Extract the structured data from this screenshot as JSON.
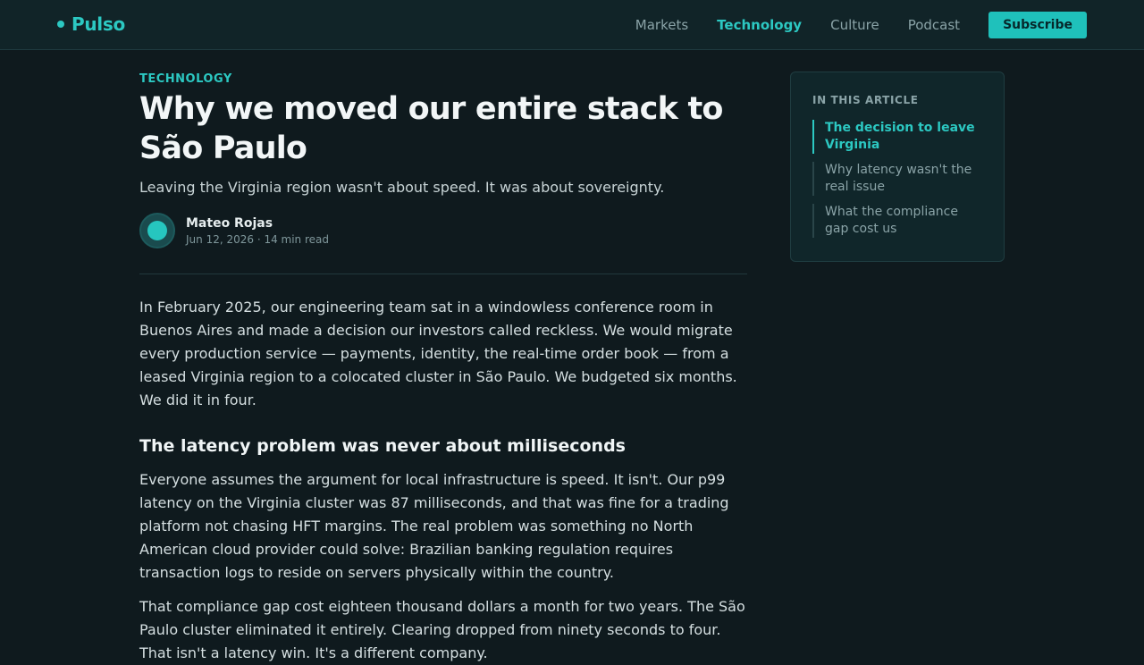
{
  "brand": {
    "name": "Pulso"
  },
  "nav": {
    "items": [
      {
        "label": "Markets"
      },
      {
        "label": "Technology",
        "active": true
      },
      {
        "label": "Culture"
      },
      {
        "label": "Podcast"
      }
    ],
    "subscribe_label": "Subscribe"
  },
  "article": {
    "kicker": "TECHNOLOGY",
    "title": "Why we moved our entire stack to São Paulo",
    "dek": "Leaving the Virginia region wasn't about speed. It was about sovereignty.",
    "author": "Mateo Rojas",
    "meta": "Jun 12, 2026 · 14 min read",
    "paragraph_1": "In February 2025, our engineering team sat in a windowless conference room in Buenos Aires and made a decision our investors called reckless. We would migrate every production service — payments, identity, the real-time order book — from a leased Virginia region to a colocated cluster in São Paulo. We budgeted six months. We did it in four.",
    "subhead_1": "The latency problem was never about milliseconds",
    "paragraph_2": "Everyone assumes the argument for local infrastructure is speed. It isn't. Our p99 latency on the Virginia cluster was 87 milliseconds, and that was fine for a trading platform not chasing HFT margins. The real problem was something no North American cloud provider could solve: Brazilian banking regulation requires transaction logs to reside on servers physically within the country.",
    "paragraph_3": "That compliance gap cost eighteen thousand dollars a month for two years. The São Paulo cluster eliminated it entirely. Clearing dropped from ninety seconds to four. That isn't a latency win. It's a different company."
  },
  "toc": {
    "title": "IN THIS ARTICLE",
    "items": [
      {
        "label": "The decision to leave Virginia",
        "active": true
      },
      {
        "label": "Why latency wasn't the real issue"
      },
      {
        "label": "What the compliance gap cost us"
      }
    ]
  },
  "colors": {
    "accent": "#2cc8c2",
    "background": "#0f1a1e",
    "header": "#112428"
  }
}
